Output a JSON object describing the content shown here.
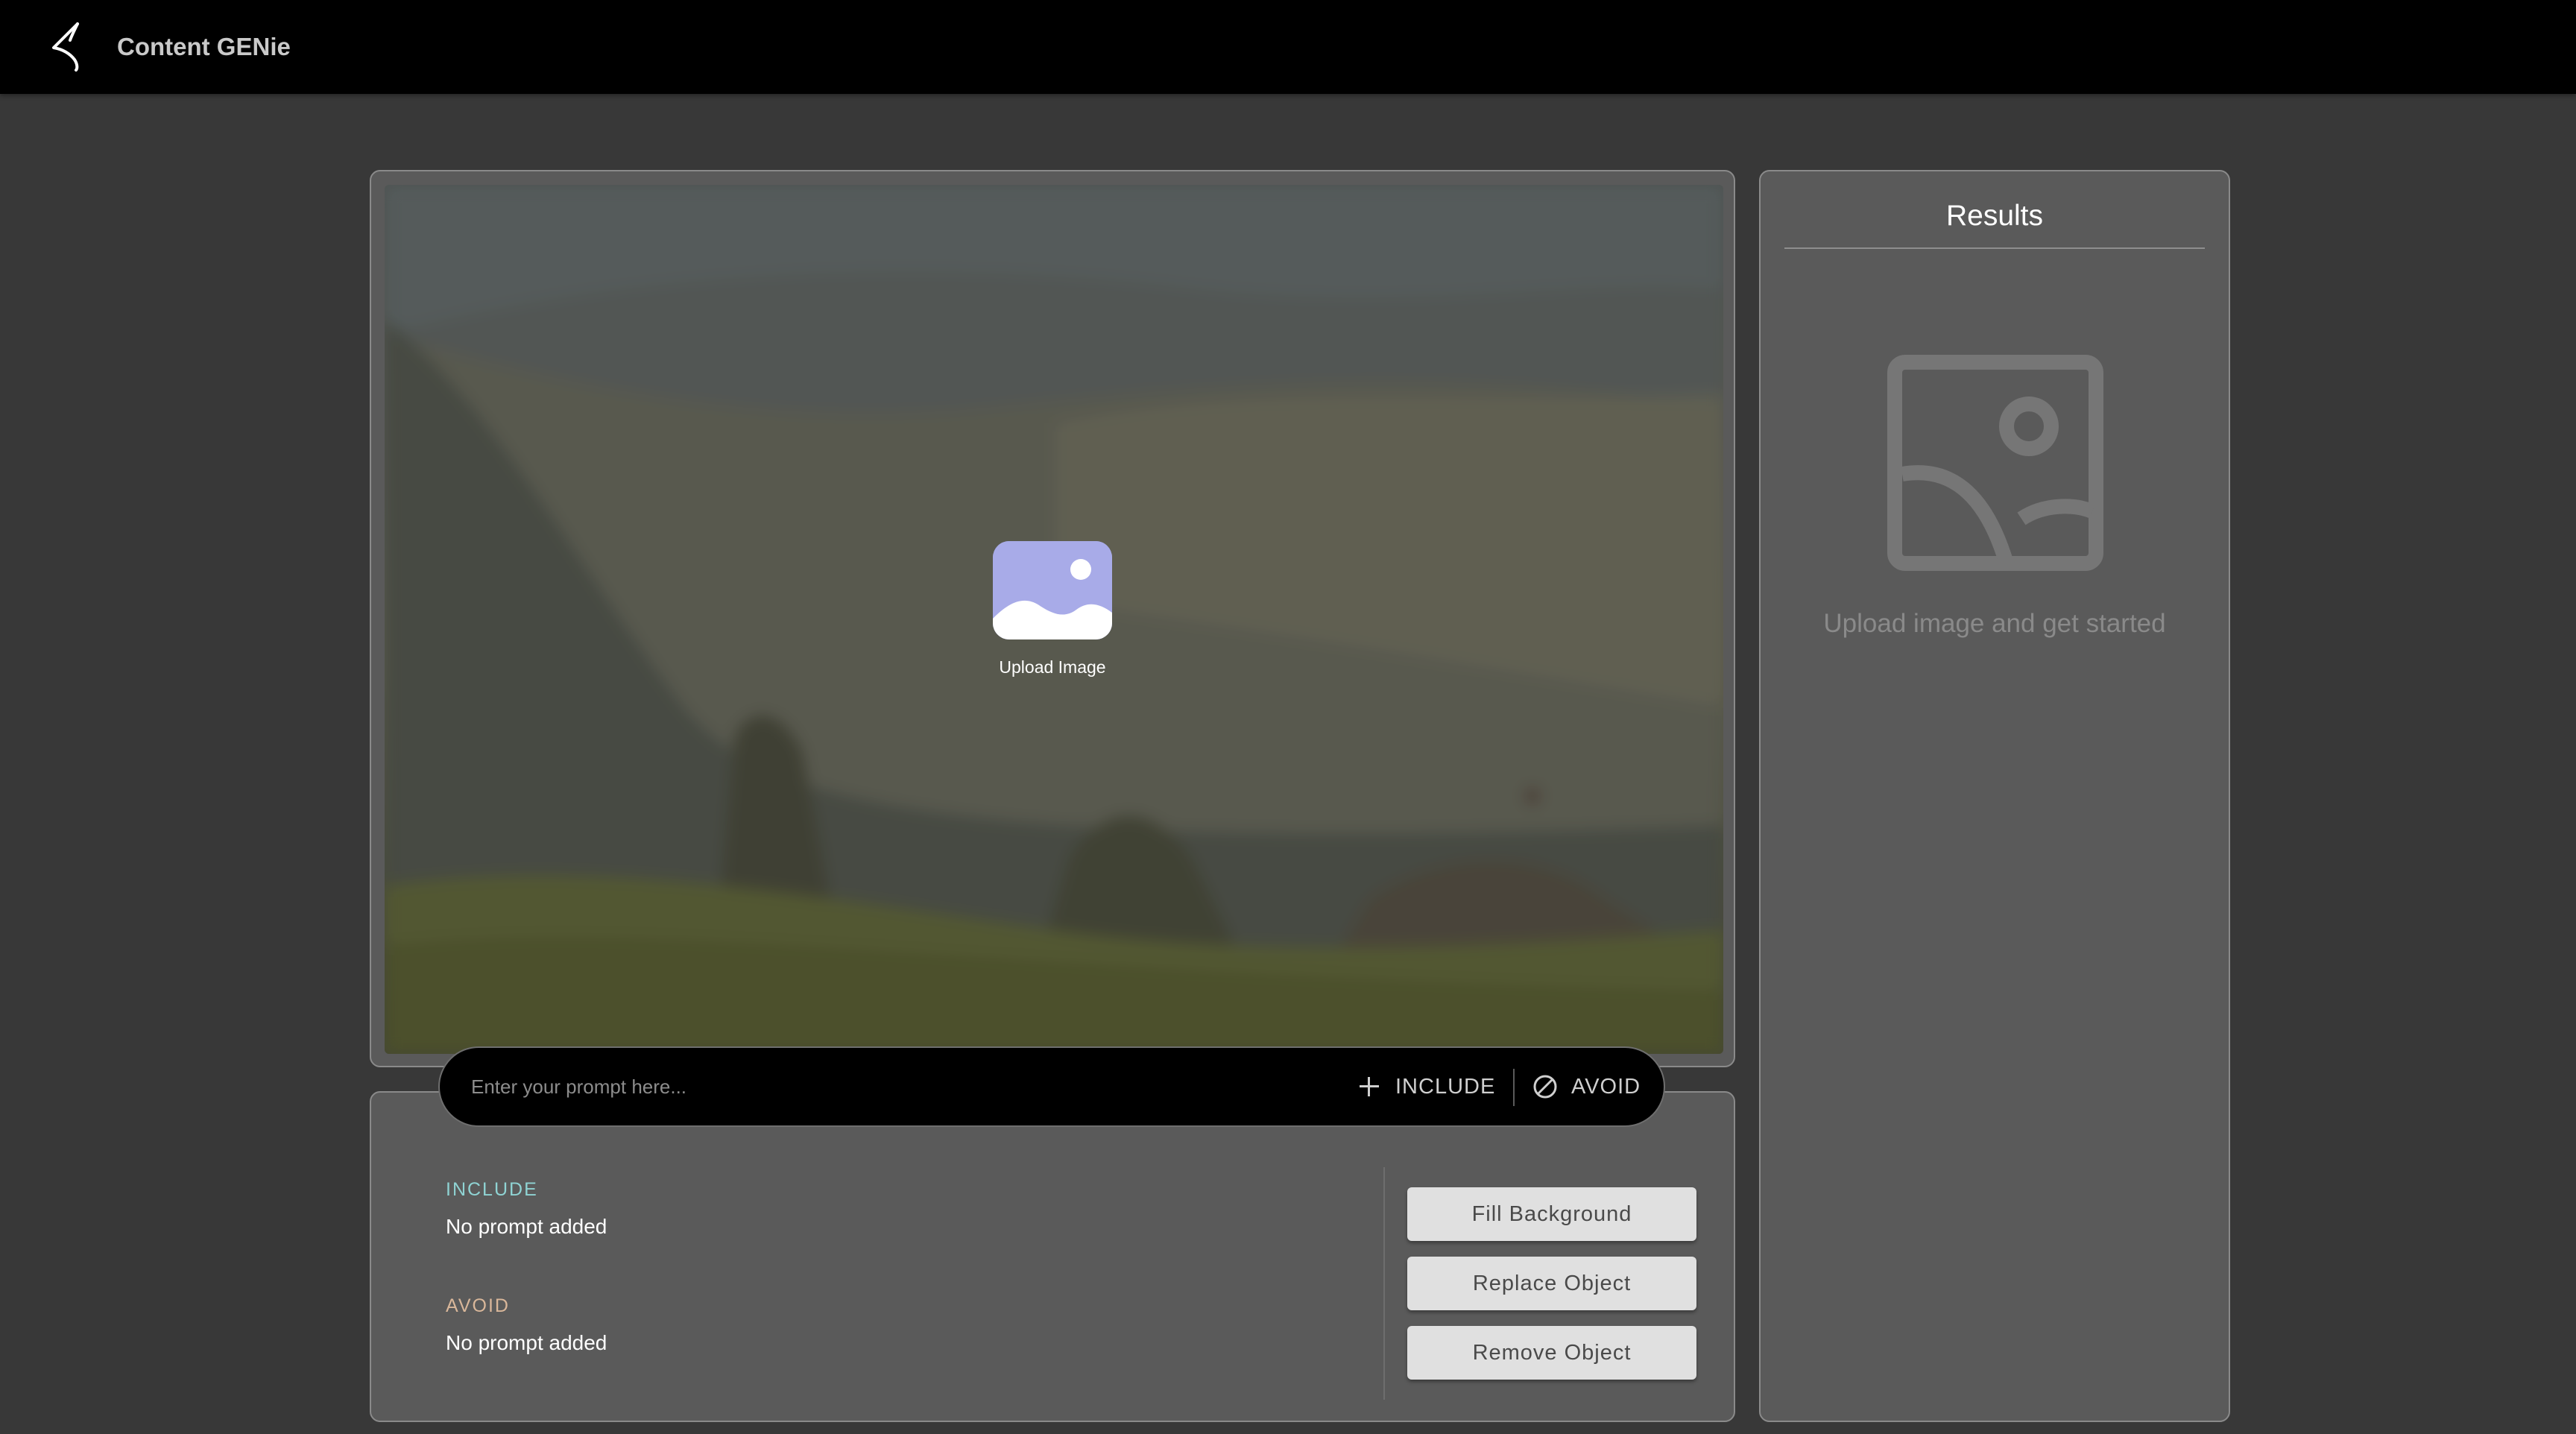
{
  "app": {
    "title": "Content GENie",
    "logo_icon": "swoosh-logo-icon"
  },
  "canvas": {
    "upload_label": "Upload Image",
    "upload_icon": "image-icon",
    "upload_icon_color": "#a8abe8"
  },
  "prompt_bar": {
    "placeholder": "Enter your prompt here...",
    "value": "",
    "include_label": "INCLUDE",
    "include_icon": "plus-icon",
    "avoid_label": "AVOID",
    "avoid_icon": "ban-icon"
  },
  "prompts": {
    "include": {
      "label": "INCLUDE",
      "value": "No prompt added",
      "color": "#8fd3d3"
    },
    "avoid": {
      "label": "AVOID",
      "value": "No prompt added",
      "color": "#d9b79a"
    }
  },
  "actions": {
    "fill_background": "Fill Background",
    "replace_object": "Replace Object",
    "remove_object": "Remove Object"
  },
  "results": {
    "title": "Results",
    "placeholder_icon": "image-placeholder-icon",
    "placeholder_text": "Upload image and get started"
  }
}
